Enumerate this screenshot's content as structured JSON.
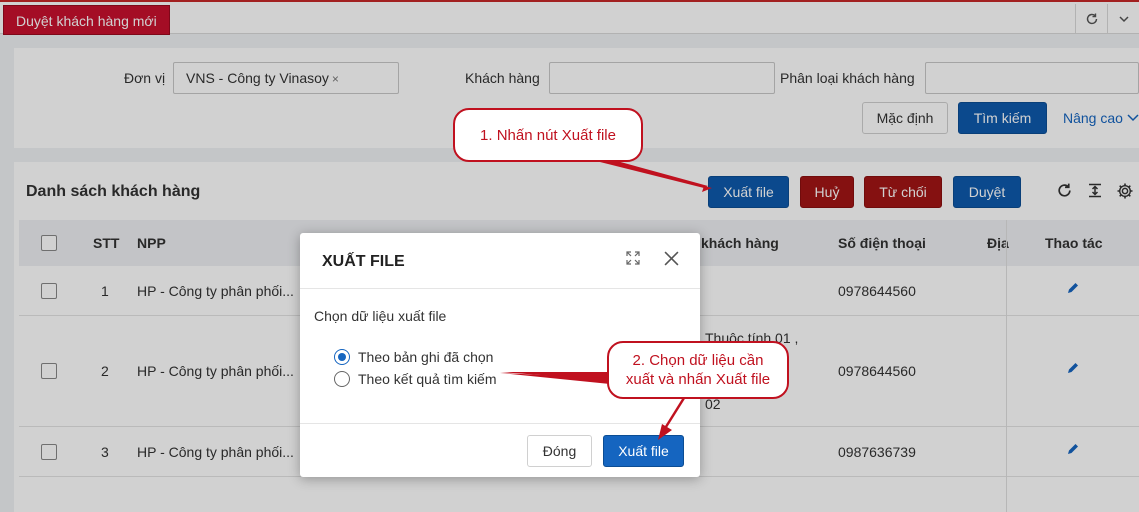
{
  "topbar": {
    "active_tab": "Duyệt khách hàng mới",
    "refresh_icon": "refresh-icon",
    "chevron_icon": "chevron-down-icon"
  },
  "filter": {
    "don_vi_label": "Đơn vị",
    "don_vi_chip": "VNS - Công ty Vinasoy",
    "chip_remove": "×",
    "khach_hang_label": "Khách hàng",
    "khach_hang_value": "",
    "phan_loai_label": "Phân loại khách hàng",
    "phan_loai_value": "",
    "mac_dinh": "Mặc định",
    "tim_kiem": "Tìm kiếm",
    "nang_cao": "Nâng cao"
  },
  "list": {
    "title": "Danh sách khách hàng",
    "buttons": {
      "xuat_file": "Xuất file",
      "huy": "Huỷ",
      "tu_choi": "Từ chối",
      "duyet": "Duyệt"
    },
    "tool_icons": [
      "refresh-icon",
      "column-height-icon",
      "gear-icon"
    ],
    "columns": {
      "stt": "STT",
      "npp": "NPP",
      "khach_hang": "khách hàng",
      "sdt": "Số điện thoại",
      "dia": "Địa",
      "thao_tac": "Thao tác"
    },
    "rows": [
      {
        "stt": "1",
        "npp": "HP - Công ty phân phối...",
        "khach_hang": "",
        "sdt": "0978644560"
      },
      {
        "stt": "2",
        "npp": "HP - Công ty phân phối...",
        "khach_hang_line1": "Thuộc tính 01 ,",
        "khach_hang_line2": "02",
        "sdt": "0978644560"
      },
      {
        "stt": "3",
        "npp": "HP - Công ty phân phối...",
        "khach_hang": "",
        "sdt": "0987636739"
      }
    ]
  },
  "modal": {
    "title": "XUẤT FILE",
    "subtitle": "Chọn dữ liệu xuất file",
    "options": [
      {
        "label": "Theo bản ghi đã chọn",
        "selected": true
      },
      {
        "label": "Theo kết quả tìm kiếm",
        "selected": false
      }
    ],
    "close_btn": "Đóng",
    "export_btn": "Xuất file"
  },
  "callouts": {
    "step1": "1. Nhấn nút Xuất file",
    "step2_line1": "2. Chọn dữ liệu cần",
    "step2_line2": "xuất và nhấn Xuất file"
  },
  "colors": {
    "brand_red": "#c8102e",
    "primary_blue": "#0e5aad",
    "callout_red": "#c0111f"
  }
}
